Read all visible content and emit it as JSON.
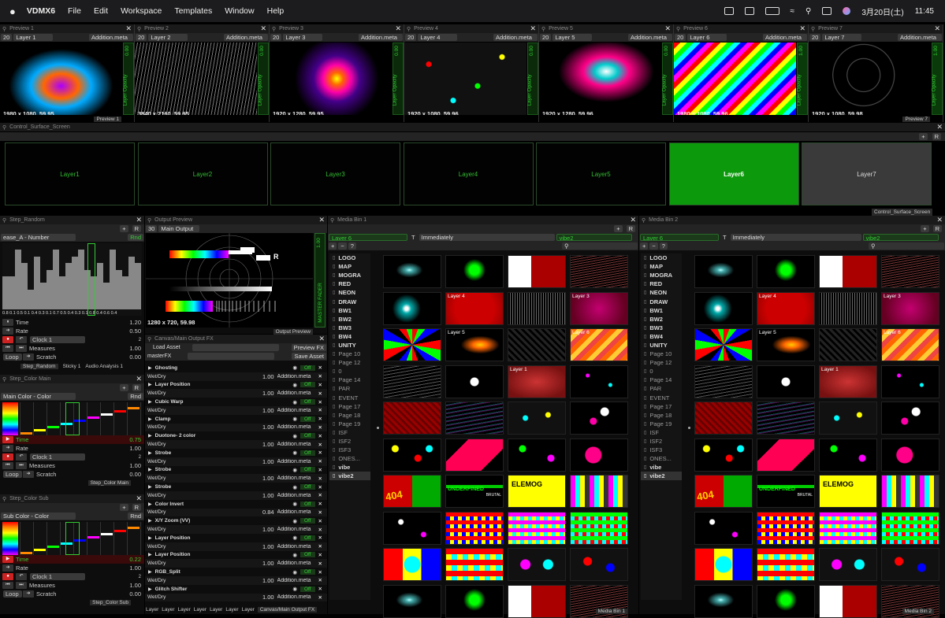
{
  "menubar": {
    "apple": "",
    "app": "VDMX6",
    "items": [
      "File",
      "Edit",
      "Workspace",
      "Templates",
      "Window",
      "Help"
    ],
    "date": "3月20日(土)",
    "time": "11:45"
  },
  "previews": [
    {
      "title": "Preview 1",
      "fps": "20",
      "layer": "Layer 1",
      "blend": "Addition.meta",
      "opacity": "0.00",
      "opacity_label": "Layer Opacity",
      "res": "1980 x 1080, 59.95",
      "footer": "Preview 1"
    },
    {
      "title": "Preview 2",
      "fps": "20",
      "layer": "Layer 2",
      "blend": "Addition.meta",
      "opacity": "0.00",
      "opacity_label": "Layer Opacity",
      "res": "3840 x 2160, 59.95",
      "footer": ""
    },
    {
      "title": "Preview 3",
      "fps": "20",
      "layer": "Layer 3",
      "blend": "Addition.meta",
      "opacity": "0.00",
      "opacity_label": "Layer Opacity",
      "res": "1920 x 1280, 59.95",
      "footer": ""
    },
    {
      "title": "Preview 4",
      "fps": "20",
      "layer": "Layer 4",
      "blend": "Addition.meta",
      "opacity": "0.00",
      "opacity_label": "Layer Opacity",
      "res": "1920 x 1080, 59.96",
      "footer": ""
    },
    {
      "title": "Preview 5",
      "fps": "20",
      "layer": "Layer 5",
      "blend": "Addition.meta",
      "opacity": "0.00",
      "opacity_label": "Layer Opacity",
      "res": "1920 x 1280, 59.96",
      "footer": ""
    },
    {
      "title": "Preview 6",
      "fps": "20",
      "layer": "Layer 6",
      "blend": "Addition.meta",
      "opacity": "1.00",
      "opacity_label": "Layer Opacity",
      "res": "1980 x 1080, 59.96",
      "footer": ""
    },
    {
      "title": "Preview 7",
      "fps": "20",
      "layer": "Layer 7",
      "blend": "Addition.meta",
      "opacity": "1.00",
      "opacity_label": "Layer Opacity",
      "res": "1920 x 1080, 59.98",
      "footer": "Preview 7"
    }
  ],
  "control_surface": {
    "title": "Control_Surface_Screen",
    "footer": "Control_Surface_Screen",
    "buttons": [
      "Layer1",
      "Layer2",
      "Layer3",
      "Layer4",
      "Layer5",
      "Layer6",
      "Layer7"
    ],
    "active": "Layer6"
  },
  "step_random": {
    "title": "Step_Random",
    "mode": "ease_A - Number",
    "rnd": "Rnd",
    "xticks": "0.8 0.1 0.5 0.1 0.4 0.3 0.1 0.7 0.5 0.4 0.3 0.1 0.8 0.4 0.6 0.4",
    "time_label": "Time",
    "time_val": "1.20",
    "rate_label": "Rate",
    "rate_val": "0.50",
    "clock": "Clock 1",
    "clock_num": "2",
    "measures": "Measures",
    "measures_val": "1.00",
    "loop": "Loop",
    "scratch": "Scratch",
    "scratch_val": "0.00",
    "tabs": [
      "Step_Random",
      "Sticky 1",
      "Audio Analysis 1"
    ]
  },
  "step_main": {
    "title": "Step_Color Main",
    "mode": "Main Color - Color",
    "rnd": "Rnd",
    "time_label": "Time",
    "time_val": "0.75",
    "rate_label": "Rate",
    "rate_val": "1.00",
    "clock": "Clock 1",
    "clock_num": "2",
    "measures": "Measures",
    "measures_val": "1.00",
    "loop": "Loop",
    "scratch": "Scratch",
    "scratch_val": "0.00",
    "tab": "Step_Color Main"
  },
  "step_sub": {
    "title": "Step_Color Sub",
    "mode": "Sub Color - Color",
    "rnd": "Rnd",
    "time_label": "Time",
    "time_val": "0.22",
    "rate_label": "Rate",
    "rate_val": "1.00",
    "clock": "Clock 1",
    "clock_num": "2",
    "measures": "Measures",
    "measures_val": "1.00",
    "loop": "Loop",
    "scratch": "Scratch",
    "scratch_val": "0.00",
    "tab": "Step_Color Sub"
  },
  "output_preview": {
    "title": "Output Preview",
    "fps": "30",
    "output": "Main Output",
    "res": "1280 x 720, 59.98",
    "fader": "MASTER FADER",
    "fader_val": "1.00",
    "footer": "Output Preview"
  },
  "canvas_fx": {
    "title": "Canvas/Main Output FX",
    "load": "Load Asset",
    "preview": "Preview FX",
    "master": "masterFX",
    "save": "Save Asset",
    "items": [
      {
        "name": "Ghosting",
        "toggle": "Off",
        "param": "Wet/Dry",
        "val": "1.00",
        "blend": "Addition.meta"
      },
      {
        "name": "Layer Position",
        "toggle": "Off",
        "param": "Wet/Dry",
        "val": "1.00",
        "blend": "Addition.meta"
      },
      {
        "name": "Cubic Warp",
        "toggle": "Off",
        "param": "Wet/Dry",
        "val": "1.00",
        "blend": "Addition.meta"
      },
      {
        "name": "Clamp",
        "toggle": "Off",
        "param": "Wet/Dry",
        "val": "1.00",
        "blend": "Addition.meta"
      },
      {
        "name": "Duotone- 2 color",
        "toggle": "Off",
        "param": "Wet/Dry",
        "val": "1.00",
        "blend": "Addition.meta"
      },
      {
        "name": "Strobe",
        "toggle": "Off",
        "param": "Wet/Dry",
        "val": "1.00",
        "blend": "Addition.meta"
      },
      {
        "name": "Strobe",
        "toggle": "Off",
        "param": "Wet/Dry",
        "val": "1.00",
        "blend": "Addition.meta"
      },
      {
        "name": "Strobe",
        "toggle": "Off",
        "param": "Wet/Dry",
        "val": "1.00",
        "blend": "Addition.meta"
      },
      {
        "name": "Color Invert",
        "toggle": "Off",
        "param": "Wet/Dry",
        "val": "0.84",
        "blend": "Addition.meta"
      },
      {
        "name": "X/Y Zoom (VV)",
        "toggle": "Off",
        "param": "Wet/Dry",
        "val": "1.00",
        "blend": "Addition.meta"
      },
      {
        "name": "Layer Position",
        "toggle": "Off",
        "param": "Wet/Dry",
        "val": "1.00",
        "blend": "Addition.meta"
      },
      {
        "name": "Layer Position",
        "toggle": "Off",
        "param": "Wet/Dry",
        "val": "1.00",
        "blend": "Addition.meta"
      },
      {
        "name": "RGB_Split",
        "toggle": "Off",
        "param": "Wet/Dry",
        "val": "1.00",
        "blend": "Addition.meta"
      },
      {
        "name": "Glitch Shifter",
        "toggle": "Off",
        "param": "Wet/Dry",
        "val": "1.00",
        "blend": "Addition.meta"
      }
    ],
    "bottom_tabs": [
      "Layer",
      "Layer",
      "Layer",
      "Layer",
      "Layer",
      "Layer",
      "Layer",
      "Canvas/Main Output FX"
    ]
  },
  "media_bin1": {
    "title": "Media Bin 1",
    "layer": "Layer 6",
    "trigger": "Immediately",
    "page": "vibe2",
    "footer": "Media Bin 1",
    "pages": [
      "LOGO",
      "MAP",
      "MOGRA",
      "RED",
      "NEON",
      "DRAW",
      "BW1",
      "BW2",
      "BW3",
      "BW4",
      "UNITY",
      "Page 10",
      "Page 12",
      "0",
      "Page 14",
      "PAR",
      "EVENT",
      "Page 17",
      "Page 18",
      "Page 19",
      "ISF",
      "ISF2",
      "ISF3",
      "ONES...",
      "vibe",
      "vibe2"
    ],
    "selected": "vibe2"
  },
  "media_bin2": {
    "title": "Media Bin 2",
    "layer": "Layer 6",
    "trigger": "Immediately",
    "page": "vibe2",
    "footer": "Media Bin 2",
    "pages": [
      "LOGO",
      "MAP",
      "MOGRA",
      "RED",
      "NEON",
      "DRAW",
      "BW1",
      "BW2",
      "BW3",
      "BW4",
      "UNITY",
      "Page 10",
      "Page 12",
      "0",
      "Page 14",
      "PAR",
      "EVENT",
      "Page 17",
      "Page 18",
      "Page 19",
      "ISF",
      "ISF2",
      "ISF3",
      "ONES...",
      "vibe",
      "vibe2"
    ],
    "selected": "vibe2"
  },
  "thumb_labels": {
    "t4": "Layer 4",
    "t3": "Layer 3",
    "t5": "Layer 5",
    "t6": "Layer 6",
    "t1": "Layer 1",
    "brutal": "BRUTAL",
    "elemog": "ELEMOG",
    "underfined": "UNDERFINED",
    "num404": "404"
  }
}
